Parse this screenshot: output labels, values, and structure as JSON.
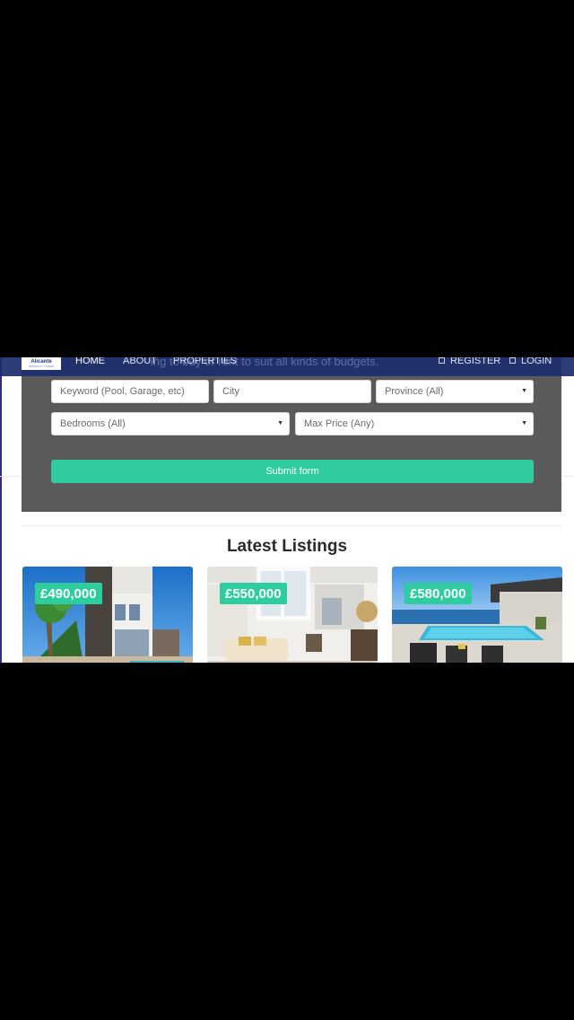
{
  "nav": {
    "logo_line1": "Alicante",
    "logo_line2": "PROPERTY FINDER",
    "items": [
      "HOME",
      "ABOUT",
      "PROPERTIES"
    ],
    "register": "REGISTER",
    "login": "LOGIN",
    "ghost_text": "ing to buy or rent to suit all kinds of budgets."
  },
  "search": {
    "keyword_placeholder": "Keyword (Pool, Garage, etc)",
    "city_placeholder": "City",
    "province_selected": "Province (All)",
    "bedrooms_selected": "Bedrooms (All)",
    "max_price_selected": "Max Price (Any)",
    "submit_label": "Submit form"
  },
  "listings": {
    "title": "Latest Listings",
    "items": [
      {
        "price": "£490,000"
      },
      {
        "price": "£550,000"
      },
      {
        "price": "£580,000"
      }
    ]
  },
  "colors": {
    "accent": "#2ecc9f",
    "navbar": "#1c2e6e",
    "panel": "#5a5a5a"
  }
}
